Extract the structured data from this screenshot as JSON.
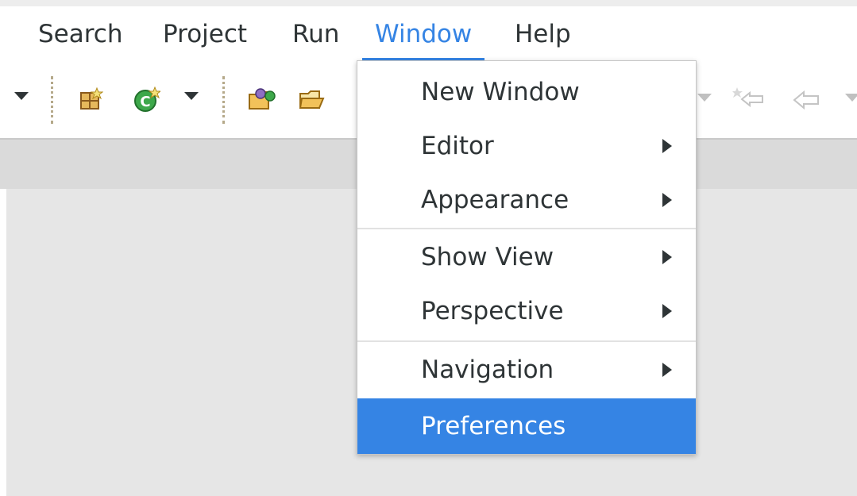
{
  "menubar": {
    "items": [
      {
        "label": "Search"
      },
      {
        "label": "Project"
      },
      {
        "label": "Run"
      },
      {
        "label": "Window"
      },
      {
        "label": "Help"
      }
    ],
    "active": "Window"
  },
  "toolbar": {
    "icons": [
      "dropdown-arrow-icon",
      "new-package-icon",
      "new-class-icon",
      "dropdown-arrow-icon",
      "open-type-icon",
      "open-folder-icon",
      "dropdown-arrow-icon",
      "last-edit-icon",
      "back-arrow-icon",
      "dropdown-arrow-icon"
    ]
  },
  "window_menu": {
    "items": [
      {
        "label": "New Window",
        "submenu": false
      },
      {
        "label": "Editor",
        "submenu": true
      },
      {
        "label": "Appearance",
        "submenu": true
      },
      {
        "label": "Show View",
        "submenu": true
      },
      {
        "label": "Perspective",
        "submenu": true
      },
      {
        "label": "Navigation",
        "submenu": true
      },
      {
        "label": "Preferences",
        "submenu": false,
        "selected": true
      }
    ]
  },
  "colors": {
    "accent": "#3584e4",
    "workspace": "#e6e6e6",
    "band": "#dadada"
  }
}
